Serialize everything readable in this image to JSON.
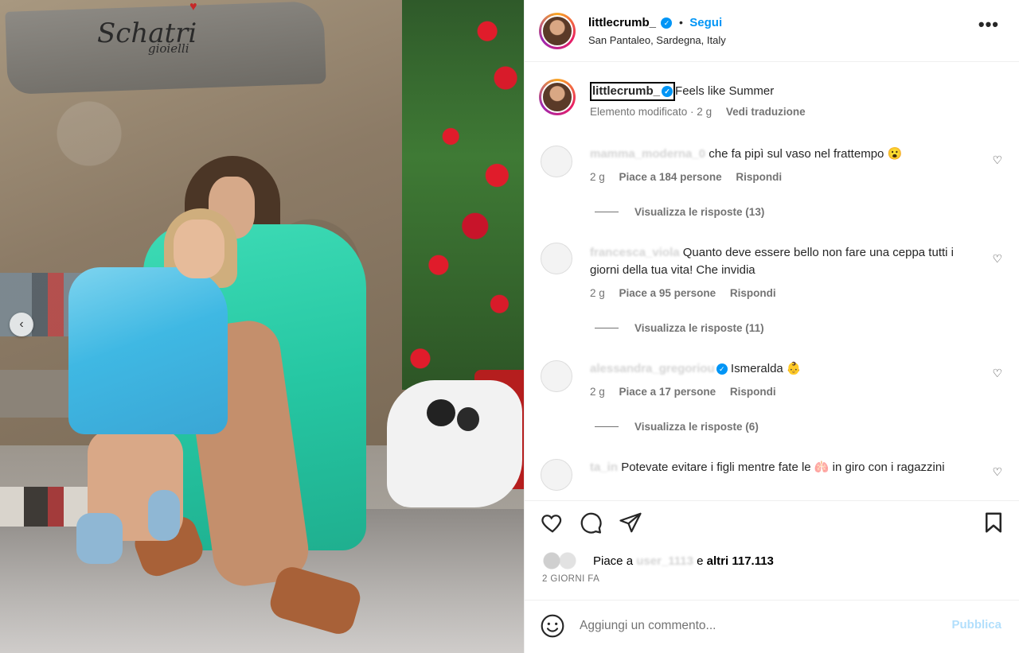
{
  "photo": {
    "sign_text": "Schatri",
    "sign_sub": "gioielli"
  },
  "header": {
    "username": "littlecrumb_",
    "separator": "•",
    "follow_label": "Segui",
    "location": "San Pantaleo, Sardegna, Italy",
    "more_label": "•••"
  },
  "caption": {
    "username": "littlecrumb_",
    "text": "Feels like Summer",
    "edited": "Elemento modificato · 2 g",
    "translate": "Vedi traduzione"
  },
  "comments": [
    {
      "user": "mamma_moderna_0",
      "text": "che fa pipì sul vaso nel frattempo 😮",
      "time": "2 g",
      "likes": "Piace a 184 persone",
      "reply": "Rispondi",
      "view_replies": "Visualizza le risposte (13)"
    },
    {
      "user": "francesca_viola",
      "text": "Quanto deve essere bello non fare una ceppa tutti i giorni della tua vita! Che invidia",
      "time": "2 g",
      "likes": "Piace a 95 persone",
      "reply": "Rispondi",
      "view_replies": "Visualizza le risposte (11)"
    },
    {
      "user": "alessandra_gregoriou",
      "text": "Ismeralda 👶",
      "time": "2 g",
      "likes": "Piace a 17 persone",
      "reply": "Rispondi",
      "view_replies": "Visualizza le risposte (6)"
    },
    {
      "user": "ta_in",
      "text": "Potevate evitare i figli mentre fate le 🫁 in giro con i ragazzini",
      "time": "",
      "likes": "",
      "reply": "",
      "view_replies": ""
    }
  ],
  "likes": {
    "prefix": "Piace a",
    "blurred_user": "user_1113",
    "middle": "e",
    "others": "altri 117.113"
  },
  "date": "2 GIORNI FA",
  "add_comment": {
    "placeholder": "Aggiungi un commento...",
    "publish": "Pubblica"
  },
  "colors": {
    "accent": "#0095f6",
    "publish_disabled": "#b2dffc"
  }
}
